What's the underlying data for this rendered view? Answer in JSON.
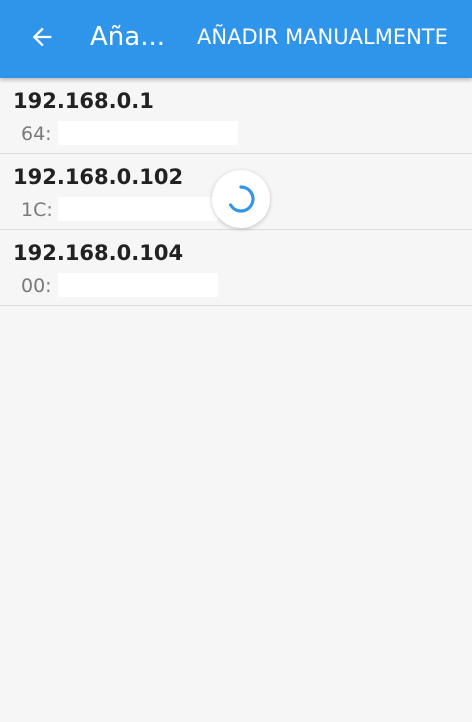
{
  "appbar": {
    "title": "Aña...",
    "action_label": "AÑADIR MANUALMENTE",
    "back_icon": "arrow-left-icon",
    "background_color": "#2f95ea"
  },
  "devices": [
    {
      "ip": "192.168.0.1",
      "mac": "64:"
    },
    {
      "ip": "192.168.0.102",
      "mac": "1C:"
    },
    {
      "ip": "192.168.0.104",
      "mac": "00:"
    }
  ],
  "loading_indicator": {
    "icon": "loading-spinner-icon",
    "color": "#2f95ea"
  }
}
